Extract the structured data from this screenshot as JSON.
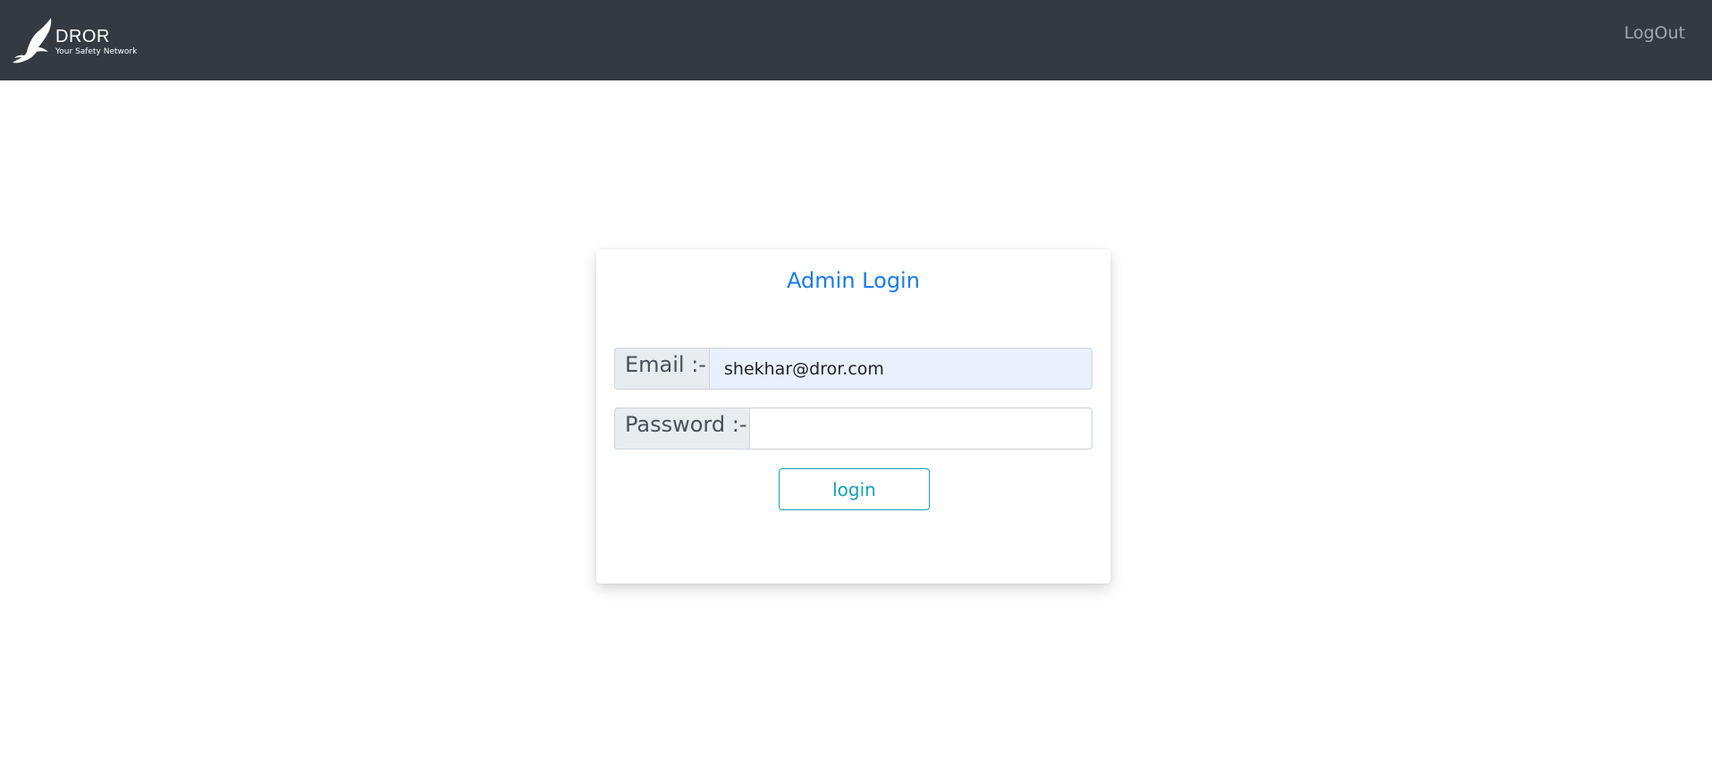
{
  "navbar": {
    "brand_name": "DROR",
    "brand_tagline": "Your Safety Network",
    "logout_label": "LogOut",
    "background_color": "#343a40"
  },
  "login_card": {
    "title": "Admin Login",
    "email": {
      "label": "Email :-",
      "value": "shekhar@dror.com"
    },
    "password": {
      "label": "Password :-",
      "value": ""
    },
    "submit_label": "login",
    "accent_color": "#1a7be9",
    "button_color": "#17a2b8"
  }
}
